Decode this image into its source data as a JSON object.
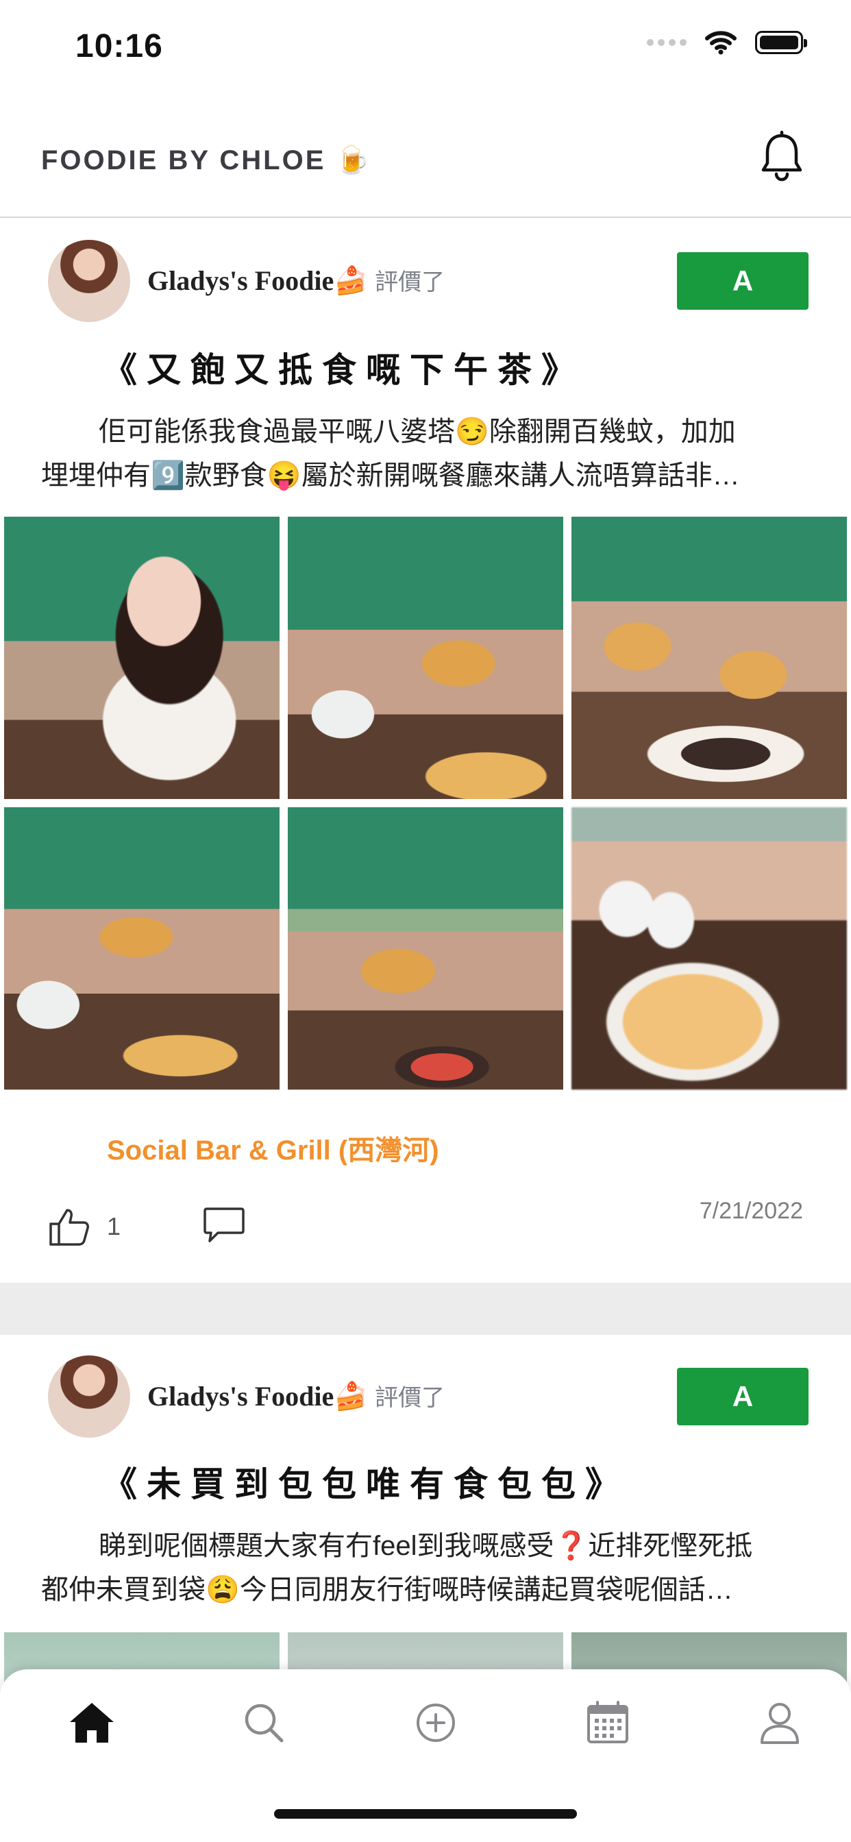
{
  "status_bar": {
    "time": "10:16"
  },
  "header": {
    "title": "FOODIE BY CHLOE 🍺"
  },
  "posts": [
    {
      "author": "Gladys's Foodie🍰",
      "action": "評價了",
      "grade": "A",
      "title": "《又飽又抵食嘅下午茶》",
      "excerpt_line1": "佢可能係我食過最平嘅八婆塔😏除翻開百幾蚊，加加",
      "excerpt_line2": "埋埋仲有9️⃣款野食😝屬於新開嘅餐廳來講人流唔算話非…",
      "restaurant": "Social Bar & Grill (西灣河)",
      "likes": "1",
      "date": "7/21/2022"
    },
    {
      "author": "Gladys's Foodie🍰",
      "action": "評價了",
      "grade": "A",
      "title": "《未買到包包唯有食包包》",
      "excerpt_line1": "睇到呢個標題大家有冇feel到我嘅感受❓近排死慳死抵",
      "excerpt_line2": "都仲未買到袋😩今日同朋友行街嘅時候講起買袋呢個話…"
    }
  ],
  "tab_bar": {
    "items": [
      {
        "icon": "home-icon",
        "active": true
      },
      {
        "icon": "search-icon",
        "active": false
      },
      {
        "icon": "add-circle-icon",
        "active": false
      },
      {
        "icon": "calendar-icon",
        "active": false
      },
      {
        "icon": "profile-icon",
        "active": false
      }
    ]
  },
  "colors": {
    "grade_badge": "#189a3f",
    "restaurant_link": "#f2902c",
    "separator": "#ececec"
  }
}
